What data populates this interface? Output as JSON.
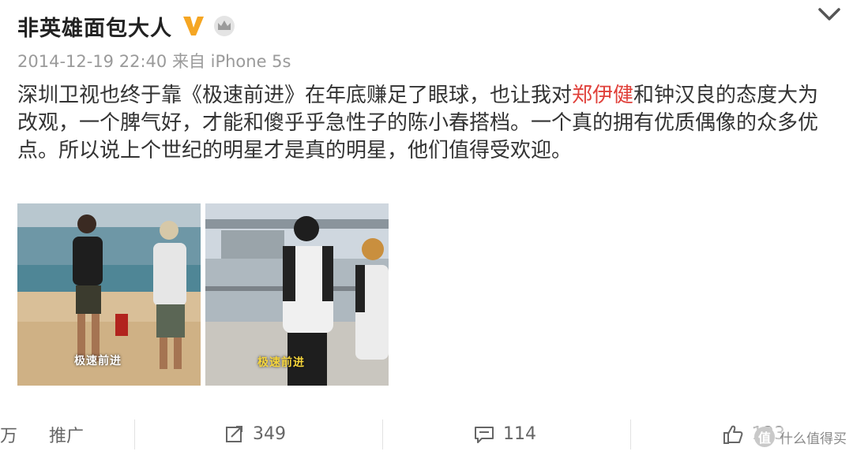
{
  "user": {
    "name": "非英雄面包大人",
    "verified_icon": "vip-v-icon",
    "badge_icon": "crown-icon"
  },
  "post": {
    "timestamp": "2014-12-19 22:40",
    "source_prefix": "来自",
    "source": "iPhone 5s",
    "text_before": "深圳卫视也终于靠《极速前进》在年底赚足了眼球，也让我对",
    "highlight": "郑伊健",
    "text_after": "和钟汉良的态度大为改观，一个脾气好，才能和傻乎乎急性子的陈小春搭档。一个真的拥有优质偶像的众多优点。所以说上个世纪的明星才是真的明星，他们值得受欢迎。",
    "image1_caption": "极速前进",
    "image2_caption": "极速前进"
  },
  "toolbar": {
    "promote_partial": "万",
    "promote_label": "推广",
    "repost_count": "349",
    "comment_count": "114",
    "like_count": "133"
  },
  "watermark": {
    "logo": "值",
    "text": "什么值得买"
  },
  "colors": {
    "highlight": "#e0403a",
    "verified": "#f5a623"
  }
}
